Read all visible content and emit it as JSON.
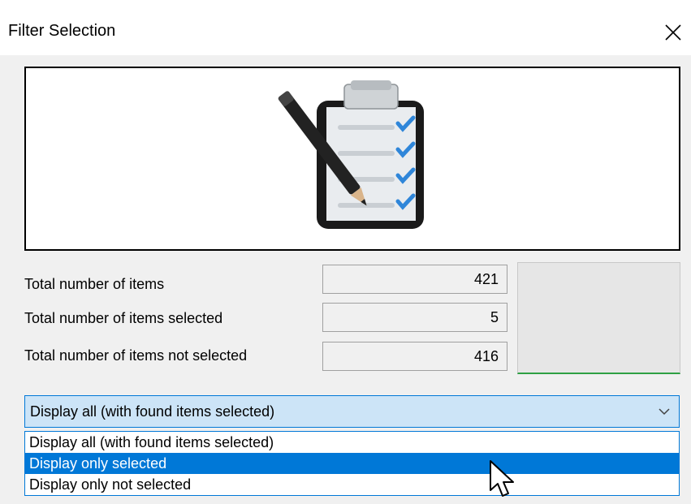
{
  "dialog": {
    "title": "Filter Selection",
    "close_icon": "close-icon"
  },
  "illustration": {
    "icon": "clipboard-checklist-pencil-icon"
  },
  "stats": {
    "total_label": "Total number of items",
    "total_value": "421",
    "selected_label": "Total number of items selected",
    "selected_value": "5",
    "not_selected_label": "Total number of items not selected",
    "not_selected_value": "416"
  },
  "display_combo": {
    "selected": "Display all (with found items selected)",
    "arrow_icon": "chevron-down-icon",
    "options": [
      "Display all (with found items selected)",
      "Display only selected",
      "Display only not selected"
    ],
    "highlighted_index": 1
  },
  "colors": {
    "accent": "#0078d7",
    "combo_bg": "#cce4f7",
    "panel_green": "#2ea043"
  }
}
